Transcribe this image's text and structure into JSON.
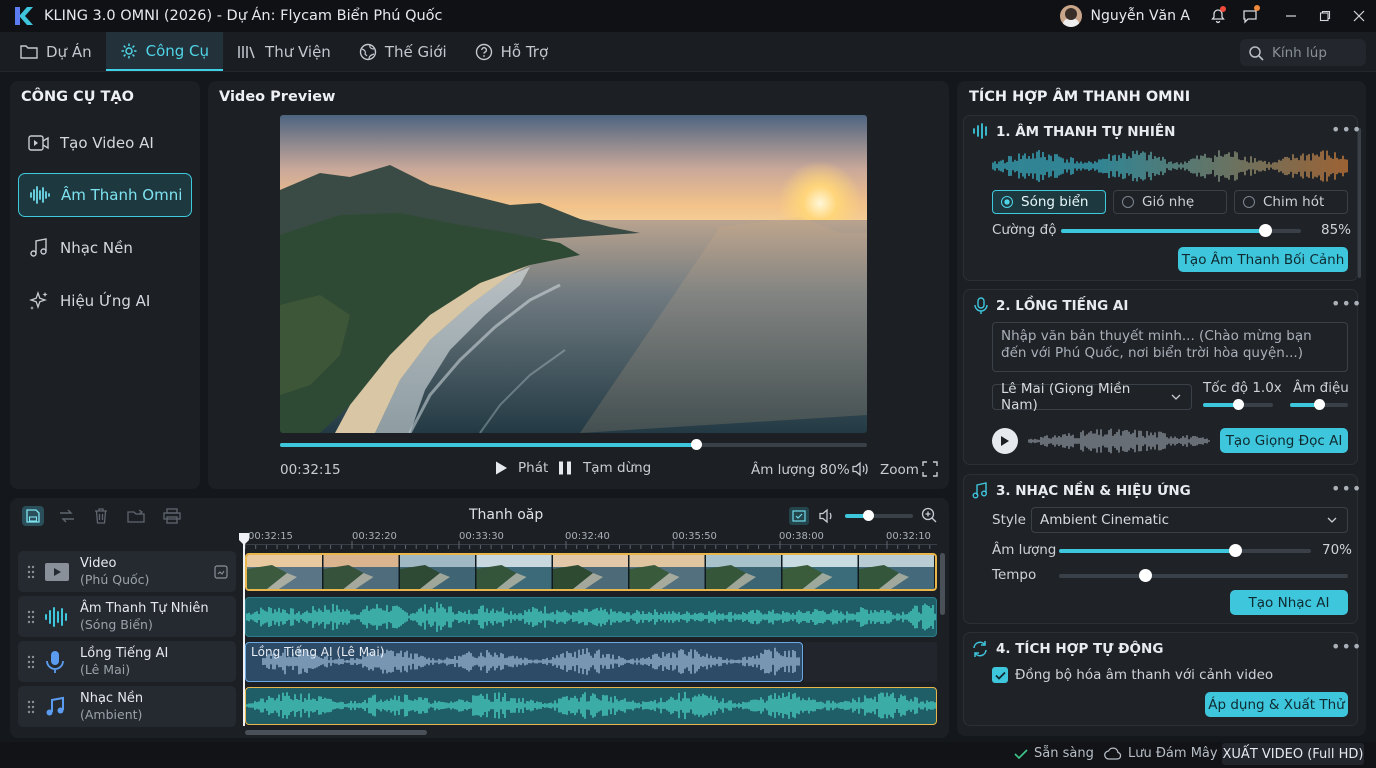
{
  "app": {
    "title": "KLING 3.0 OMNI (2026) - Dự Án: Flycam Biển Phú Quốc",
    "user": "Nguyễn Văn A"
  },
  "menu": {
    "tabs": [
      "Dự Án",
      "Công Cụ",
      "Thư Viện",
      "Thế Giới",
      "Hỗ Trợ"
    ],
    "active": "Công Cụ",
    "search_placeholder": "Kính lúp"
  },
  "tools": {
    "title": "CÔNG CỤ TẠO",
    "items": [
      "Tạo Video AI",
      "Âm Thanh Omni",
      "Nhạc Nền",
      "Hiệu Ứng AI"
    ],
    "active": "Âm Thanh Omni"
  },
  "preview": {
    "title": "Video Preview",
    "time": "00:32:15",
    "progress": 0.71,
    "play": "Phát",
    "pause": "Tạm dừng",
    "volume": "Âm lượng 80%",
    "zoom": "Zoom"
  },
  "timeline": {
    "title": "Thanh oăp",
    "zoom_level": 0.35,
    "ruler": [
      "00:32:15",
      "00:32:20",
      "00:33:30",
      "00:32:40",
      "00:35:50",
      "00:38:00",
      "00:32:10"
    ],
    "tracks": [
      {
        "name": "Video",
        "sub": "(Phú Quốc)"
      },
      {
        "name": "Âm Thanh Tự Nhiên",
        "sub": "(Sóng Biển)"
      },
      {
        "name": "Lồng Tiếng AI",
        "sub": "(Lê Mai)"
      },
      {
        "name": "Nhạc Nền",
        "sub": "(Ambient)"
      }
    ],
    "voice_clip": "Lồng Tiếng AI (Lê Mai)"
  },
  "audio": {
    "title": "TÍCH HỢP ÂM THANH OMNI",
    "natural": {
      "title": "1. ÂM THANH TỰ NHIÊN",
      "options": [
        "Sóng biển",
        "Gió nhẹ",
        "Chim hót"
      ],
      "selected": "Sóng biển",
      "intensity_label": "Cường độ",
      "intensity": "85%",
      "intensity_value": 0.85,
      "button": "Tạo Âm Thanh Bối Cảnh"
    },
    "voice": {
      "title": "2. LỒNG TIẾNG AI",
      "text": "Nhập văn bản thuyết minh... (Chào mừng bạn đến với Phú Quốc, nơi biển trời hòa quyện...)",
      "voice": "Lê Mai (Giọng Miền Nam)",
      "speed_label": "Tốc độ 1.0x",
      "speed_value": 0.5,
      "tone_label": "Âm điệu",
      "tone_value": 0.5,
      "button": "Tạo Giọng Đọc AI"
    },
    "music": {
      "title": "3. NHẠC NỀN & HIỆU ỨNG",
      "style_label": "Style",
      "style": "Ambient Cinematic",
      "volume_label": "Âm lượng",
      "volume": "70%",
      "volume_value": 0.7,
      "tempo_label": "Tempo",
      "tempo_value": 0.3,
      "button": "Tạo Nhạc AI"
    },
    "auto": {
      "title": "4. TÍCH HỢP TỰ ĐỘNG",
      "checkbox": "Đồng bộ hóa âm thanh với cảnh video",
      "checked": true,
      "button": "Áp dụng & Xuất Thử"
    }
  },
  "status": {
    "ready": "Sẵn sàng",
    "cloud": "Lưu Đám Mây",
    "export": "XUẤT VIDEO (Full HD)"
  },
  "colors": {
    "accent": "#3ec6dc",
    "clip_outline": "#e8b64a",
    "bg": "#14171c"
  }
}
